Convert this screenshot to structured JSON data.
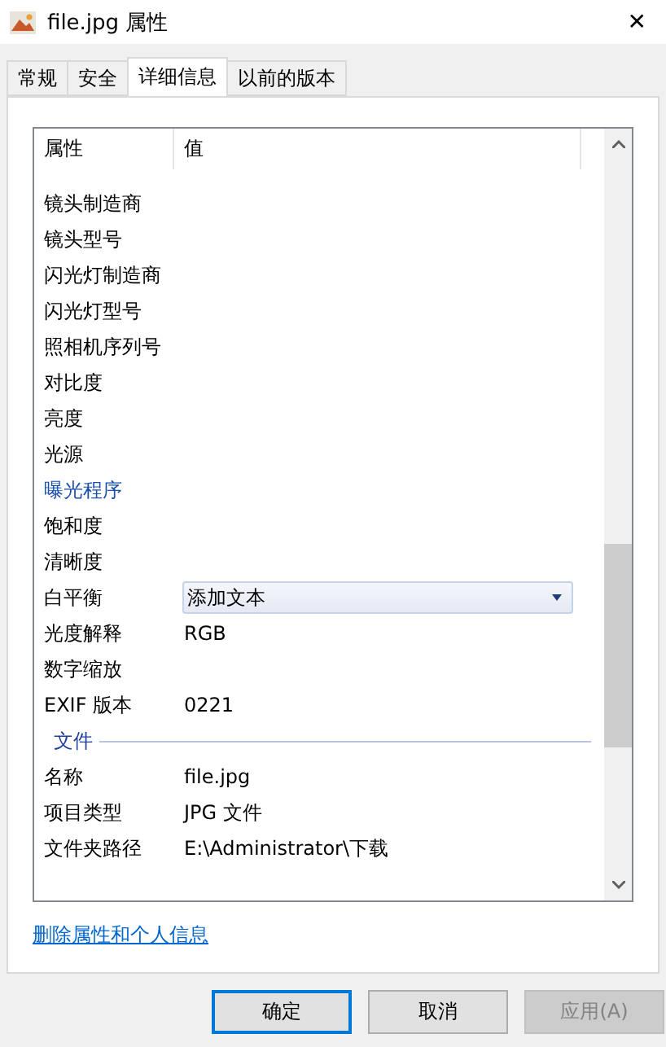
{
  "window": {
    "title": "file.jpg 属性",
    "close": "✕"
  },
  "tabs": [
    {
      "label": "常规",
      "selected": false
    },
    {
      "label": "安全",
      "selected": false
    },
    {
      "label": "详细信息",
      "selected": true
    },
    {
      "label": "以前的版本",
      "selected": false
    }
  ],
  "table": {
    "columns": [
      "属性",
      "值"
    ],
    "rows": [
      {
        "kind": "text",
        "name": "镜头制造商",
        "value": "",
        "highlighted": false
      },
      {
        "kind": "text",
        "name": "镜头型号",
        "value": "",
        "highlighted": false
      },
      {
        "kind": "text",
        "name": "闪光灯制造商",
        "value": "",
        "highlighted": false
      },
      {
        "kind": "text",
        "name": "闪光灯型号",
        "value": "",
        "highlighted": false
      },
      {
        "kind": "text",
        "name": "照相机序列号",
        "value": "",
        "highlighted": false
      },
      {
        "kind": "text",
        "name": "对比度",
        "value": "",
        "highlighted": false
      },
      {
        "kind": "text",
        "name": "亮度",
        "value": "",
        "highlighted": false
      },
      {
        "kind": "text",
        "name": "光源",
        "value": "",
        "highlighted": false
      },
      {
        "kind": "text",
        "name": "曝光程序",
        "value": "",
        "highlighted": true
      },
      {
        "kind": "text",
        "name": "饱和度",
        "value": "",
        "highlighted": false
      },
      {
        "kind": "text",
        "name": "清晰度",
        "value": "",
        "highlighted": false
      },
      {
        "kind": "dropdown",
        "name": "白平衡",
        "value": "添加文本",
        "highlighted": false
      },
      {
        "kind": "text",
        "name": "光度解释",
        "value": "RGB",
        "highlighted": false
      },
      {
        "kind": "text",
        "name": "数字缩放",
        "value": "",
        "highlighted": false
      },
      {
        "kind": "text",
        "name": "EXIF 版本",
        "value": "0221",
        "highlighted": false
      },
      {
        "kind": "section",
        "name": "文件"
      },
      {
        "kind": "text",
        "name": "名称",
        "value": "file.jpg",
        "highlighted": false
      },
      {
        "kind": "text",
        "name": "项目类型",
        "value": "JPG 文件",
        "highlighted": false
      },
      {
        "kind": "text",
        "name": "文件夹路径",
        "value": "E:\\Administrator\\下载",
        "highlighted": false
      }
    ]
  },
  "link": "删除属性和个人信息",
  "buttons": [
    {
      "label": "确定",
      "default": true,
      "disabled": false
    },
    {
      "label": "取消",
      "default": false,
      "disabled": false
    },
    {
      "label": "应用(A)",
      "default": false,
      "disabled": true
    }
  ]
}
